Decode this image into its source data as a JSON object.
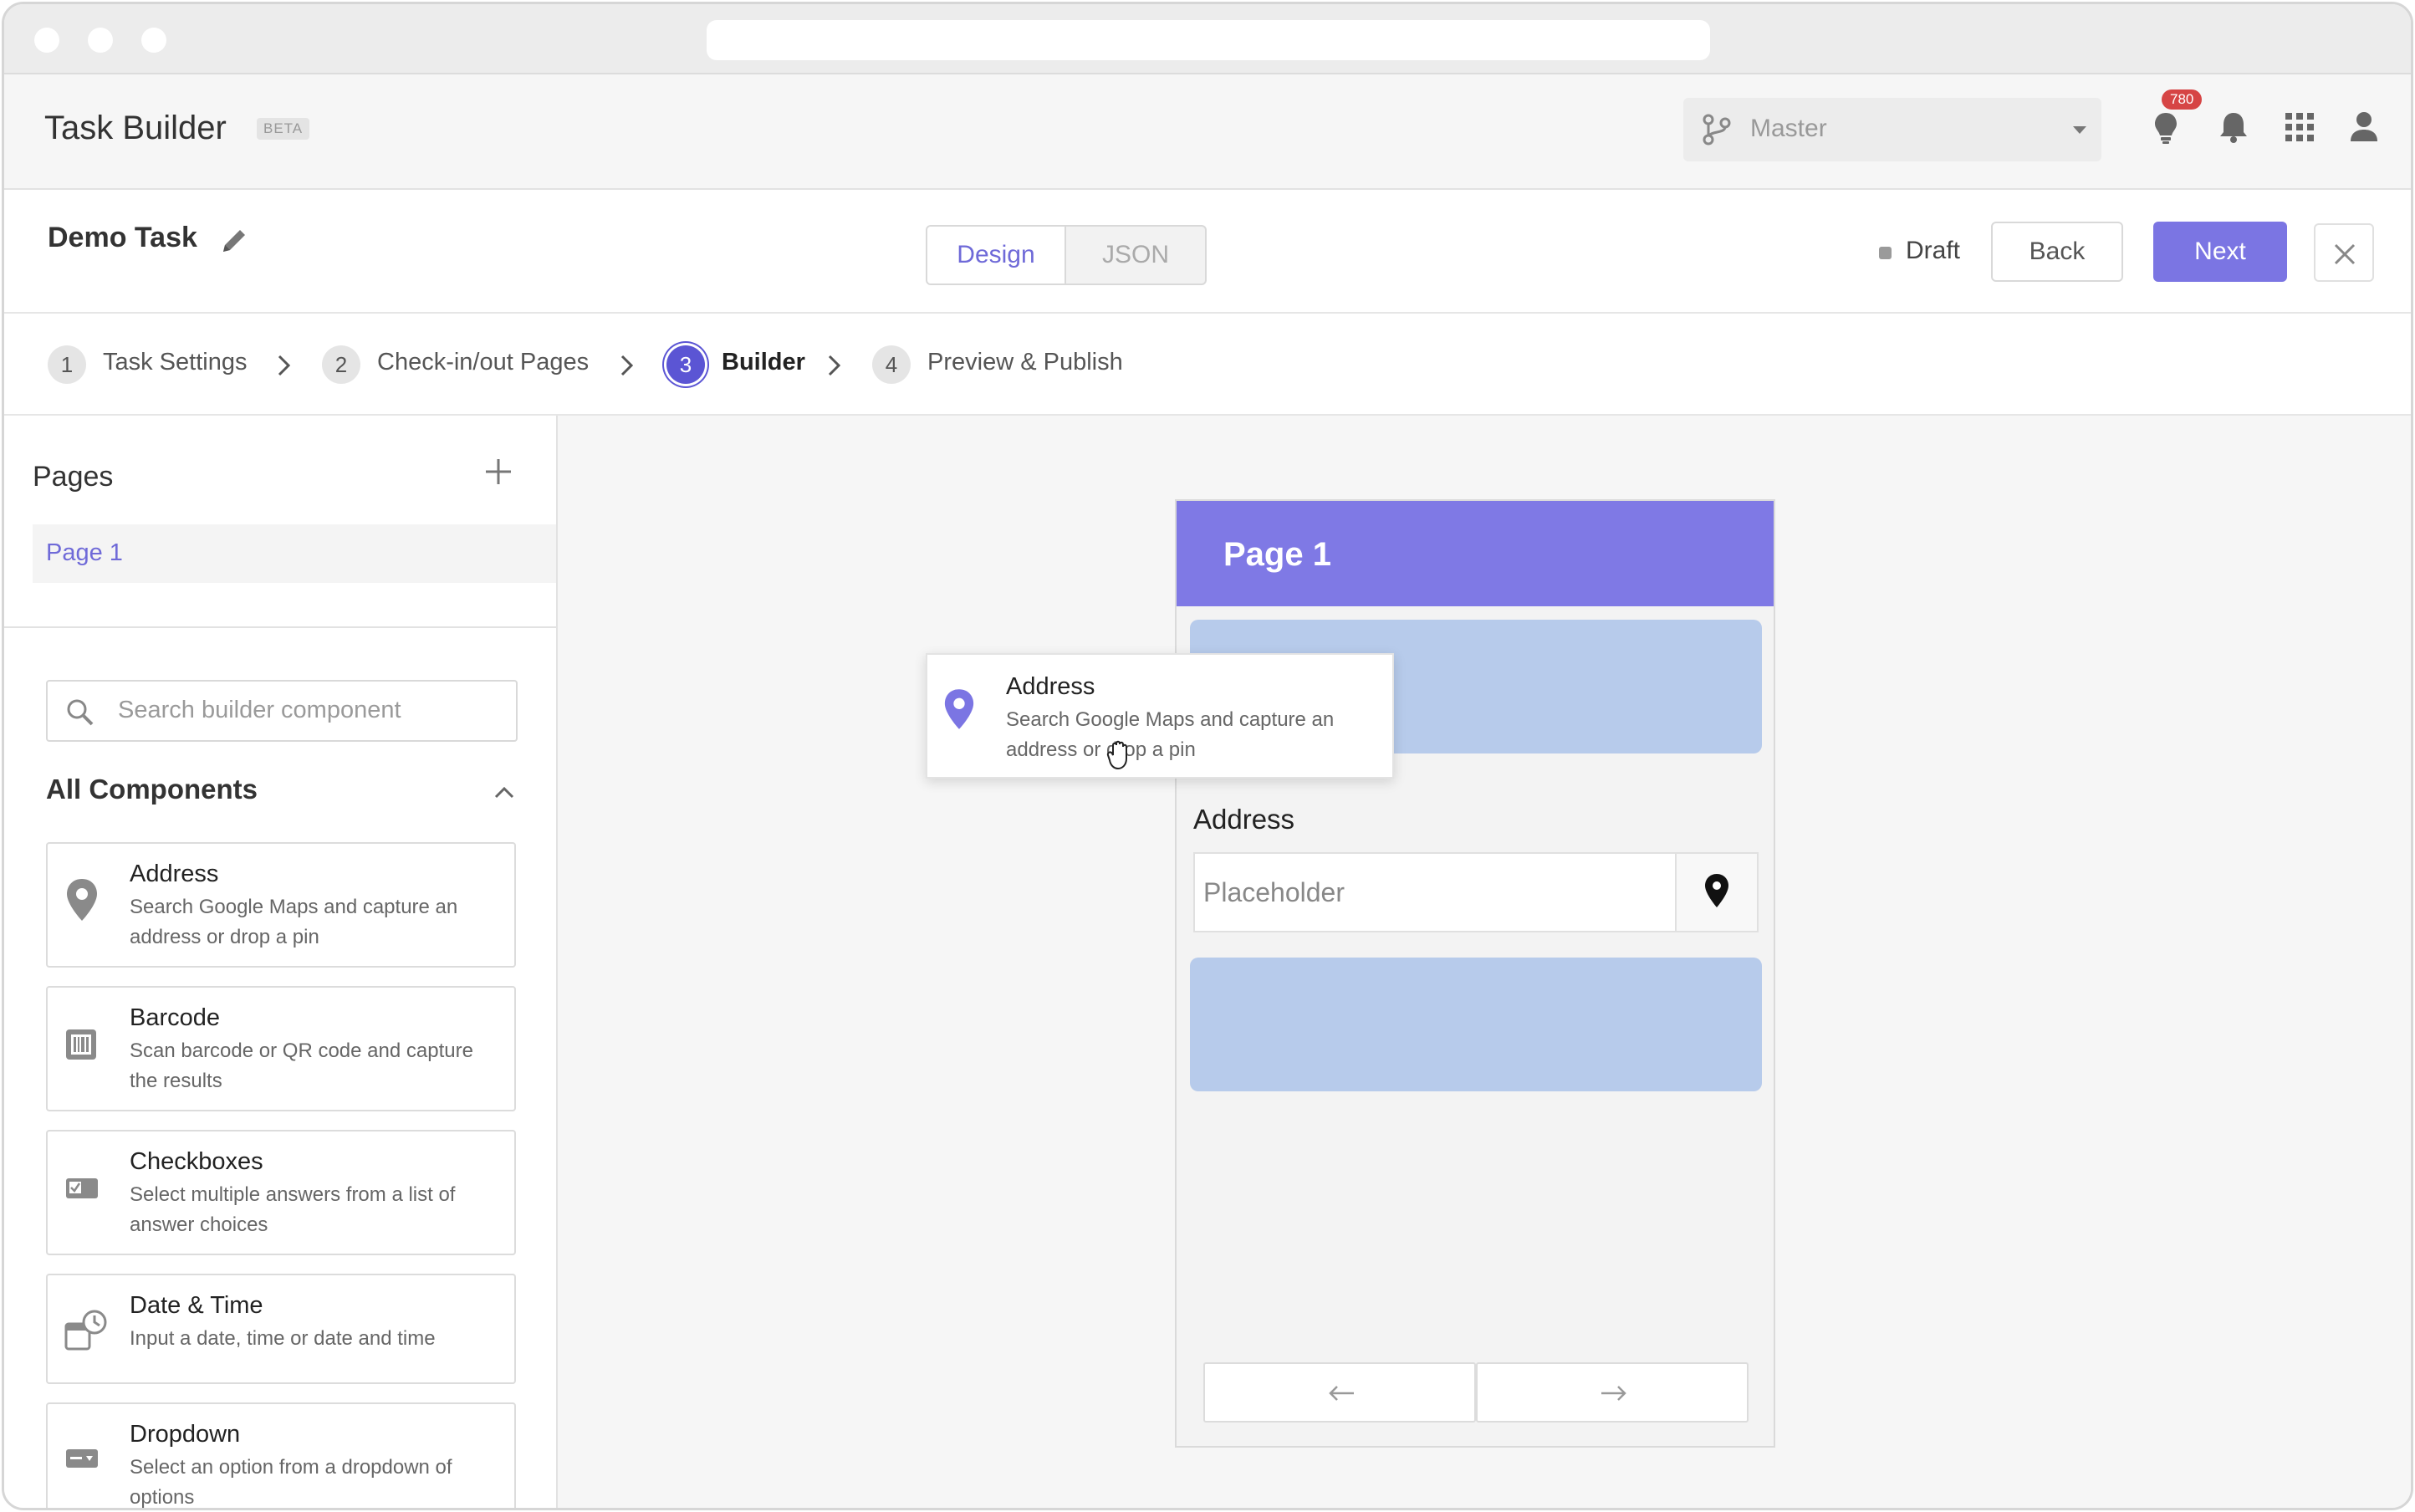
{
  "app": {
    "title": "Task Builder",
    "beta_label": "BETA",
    "branch": "Master",
    "notification_count": "780"
  },
  "task": {
    "name": "Demo Task",
    "view_tabs": [
      "Design",
      "JSON"
    ],
    "status": "Draft",
    "back_label": "Back",
    "next_label": "Next"
  },
  "steps": [
    {
      "number": "1",
      "label": "Task Settings"
    },
    {
      "number": "2",
      "label": "Check-in/out Pages"
    },
    {
      "number": "3",
      "label": "Builder"
    },
    {
      "number": "4",
      "label": "Preview & Publish"
    }
  ],
  "sidebar": {
    "pages_title": "Pages",
    "pages": [
      "Page 1"
    ],
    "search_placeholder": "Search builder component",
    "components_title": "All Components",
    "components": [
      {
        "name": "Address",
        "description": "Search Google Maps and capture an address or drop a pin",
        "icon": "map-pin-icon"
      },
      {
        "name": "Barcode",
        "description": "Scan barcode or QR code and capture the results",
        "icon": "barcode-icon"
      },
      {
        "name": "Checkboxes",
        "description": "Select multiple answers from a list of answer choices",
        "icon": "checkbox-icon"
      },
      {
        "name": "Date & Time",
        "description": "Input a date, time or date and time",
        "icon": "calendar-clock-icon"
      },
      {
        "name": "Dropdown",
        "description": "Select an option from a dropdown of options",
        "icon": "dropdown-icon"
      }
    ]
  },
  "preview": {
    "page_title": "Page 1",
    "field_label": "Address",
    "field_placeholder": "Placeholder"
  },
  "drag_ghost": {
    "name": "Address",
    "description": "Search Google Maps and capture an address or drop a pin"
  },
  "colors": {
    "accent": "#7b75e3",
    "drop_zone": "#b7cbeb",
    "badge": "#d64545"
  }
}
